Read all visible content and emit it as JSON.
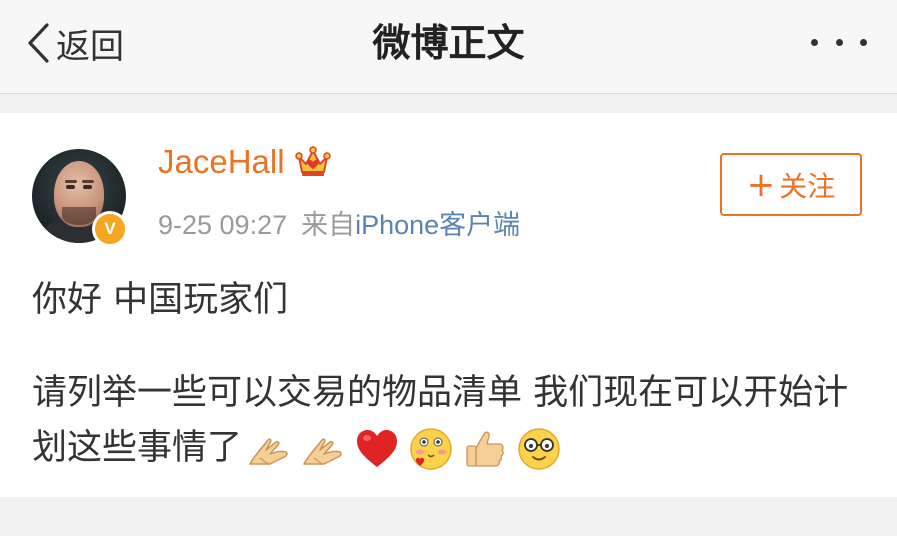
{
  "nav": {
    "back_label": "返回",
    "title": "微博正文"
  },
  "post": {
    "username": "JaceHall",
    "time": "9-25 09:27",
    "source_prefix": "来自",
    "source": "iPhone客户端",
    "follow_label": "关注",
    "verified_mark": "V",
    "paragraph1": "你好 中国玩家们",
    "paragraph2": "请列举一些可以交易的物品清单 我们现在可以开始计划这些事情了",
    "emojis": [
      "praying-hands-icon",
      "praying-hands-icon",
      "red-heart-icon",
      "blushing-face-icon",
      "thumbs-up-icon",
      "smiling-face-with-glasses-icon"
    ]
  },
  "colors": {
    "accent": "#eb7325",
    "link": "#5b84b1",
    "meta": "#9a9a9a",
    "verified": "#f5a623",
    "background": "#f2f2f2"
  }
}
